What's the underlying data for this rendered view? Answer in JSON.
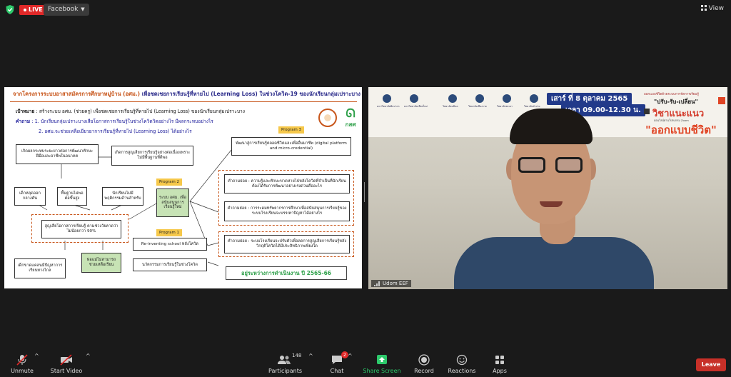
{
  "top_bar": {
    "live_label": "LIVE",
    "stream_target": "Facebook",
    "view_label": "View"
  },
  "slide": {
    "title_part1": "จากโครงการระบบอาสาสมัครการศึกษาหมู่บ้าน (อศม.)",
    "title_part2": "เพื่อชดเชยการเรียนรู้ที่หายไป (Learning Loss) ในช่วงโควิด-19  ของนักเรียนกลุ่มเปราะบาง",
    "goal_label": "เป้าหมาย",
    "goal_text": " : สร้างระบบ อศม. (ช่วยครู) เพื่อชดเชยการเรียนรู้ที่หายไป (Learning Loss) ของนักเรียนกลุ่มเปราะบาง",
    "question_label": "คำถาม",
    "question_1": " : 1. นักเรียนกลุ่มเปราะบางเสียโอกาสการเรียนรู้ในช่วงโควิดวิดอย่างไร  มีผลกระทบอย่างไร",
    "question_2": "2. อศม.จะช่วยเหลือเยียวยาการเรียนรู้ที่หายไป (Learning Loss) ได้อย่างไร",
    "logo_text": "กสศ",
    "boxes": {
      "b_future": "เกิดผลกระทบระยะยาวต่อการพัฒนาทักษะฝีมือและอาชีพในอนาคต",
      "b_loss": "เกิดการสูญเสียการเรียนรู้อย่างต่อเนื่องเพราะไม่มีพื้นฐานที่ดีพอ",
      "b_dropout": "เด็กหลุดออกกลางคัน",
      "b_weak": "พื้นฐานไม่พอต่อขั้นสูง",
      "b_unready": "นักเรียนไม่มีพฤติกรรมด้านสำหรับ",
      "b_loss90": "สูญเสียโอกาสการเรียนรู้ ตามช่วงวัยคาดว่าไม่น้อยกว่า 90%",
      "b_kids": "เด็กขาดแคลนมีปัญหาการเรียนทางไกล",
      "b_support": "พ่อแม่ไม่สามารถช่วยเหลือเรียน",
      "b_system": "ระบบ อศม. เพื่อสนับสนุนการเรียนรู้ใหม่",
      "b_reinvent": "Re-inventing school หลังโควิด",
      "b_innov": "นวัตกรรมการเรียนรู้ในช่วงโควิด",
      "b_develop": "พัฒนาสู่การเรียนรู้ตลอดชีวิตและเพื่ออื่นมาชีพ (digital platform and micro-credential)",
      "q_research1": "คำถามย่อย : ความรู้และทักษะขาดหายไปหลังโควิดที่จำเป็นที่นักเรียนต้องได้รับการพัฒนาอย่างเร่งด่วนคืออะไร",
      "q_research2": "คำถามย่อย : การระดมทรัพยากรการศึกษาเพื่อสนับสนุนการเรียนรู้ของระบบโรงเรียนจะบรรเทาปัญหาได้อย่างไร",
      "q_research3": "คำถามย่อย : ระบบโรงเรียนจะปรับตัวเพื่อลดการสูญเสียการเรียนรู้หลังวิกฤติโควิดได้มีประสิทธิภาพเพียงใด"
    },
    "program_1": "Program 1",
    "program_2": "Program 2",
    "program_3": "Program 3",
    "status": "อยู่ระหว่างการดำเนินงาน ปี 2565-66"
  },
  "camera": {
    "participant_name": "Udom EEF",
    "banner": {
      "date": "เสาร์ ที่ 8 ตุลาคม 2565",
      "time": "เวลา 09.00-12.30 น.",
      "small_top": "ออกแบบชีวิตด้วยระบบการจัดการเรียนรู้",
      "slogan": "\"ปรับ-รับ-เปลี่ยน\"",
      "course": "วิชาแนะแนว",
      "sub": "ออนไลน์ผ่านโปรแกรม Zoom ",
      "big": "\"ออกแบบชีวิต\"",
      "orgs": [
        "มหาวิทยาลัยศิลปากร",
        "มหาวิทยาลัยเชียงใหม่",
        "วิทยาลัยมหิดล",
        "วิทยาลัยเชียงราย",
        "วิทยาลัยพะเยา",
        "วิทยาลัยลำปาง"
      ]
    }
  },
  "toolbar": {
    "mute_label": "Unmute",
    "video_label": "Start Video",
    "participants_label": "Participants",
    "participants_count": "148",
    "chat_label": "Chat",
    "chat_badge": "2",
    "share_label": "Share Screen",
    "record_label": "Record",
    "reactions_label": "Reactions",
    "apps_label": "Apps",
    "leave_label": "Leave"
  },
  "colors": {
    "live": "#e02828",
    "share_green": "#2dc96b",
    "leave_red": "#c73028",
    "slide_orange": "#c8561b",
    "slide_green_box": "#c7e3b5",
    "program_yellow": "#f6c84a"
  }
}
